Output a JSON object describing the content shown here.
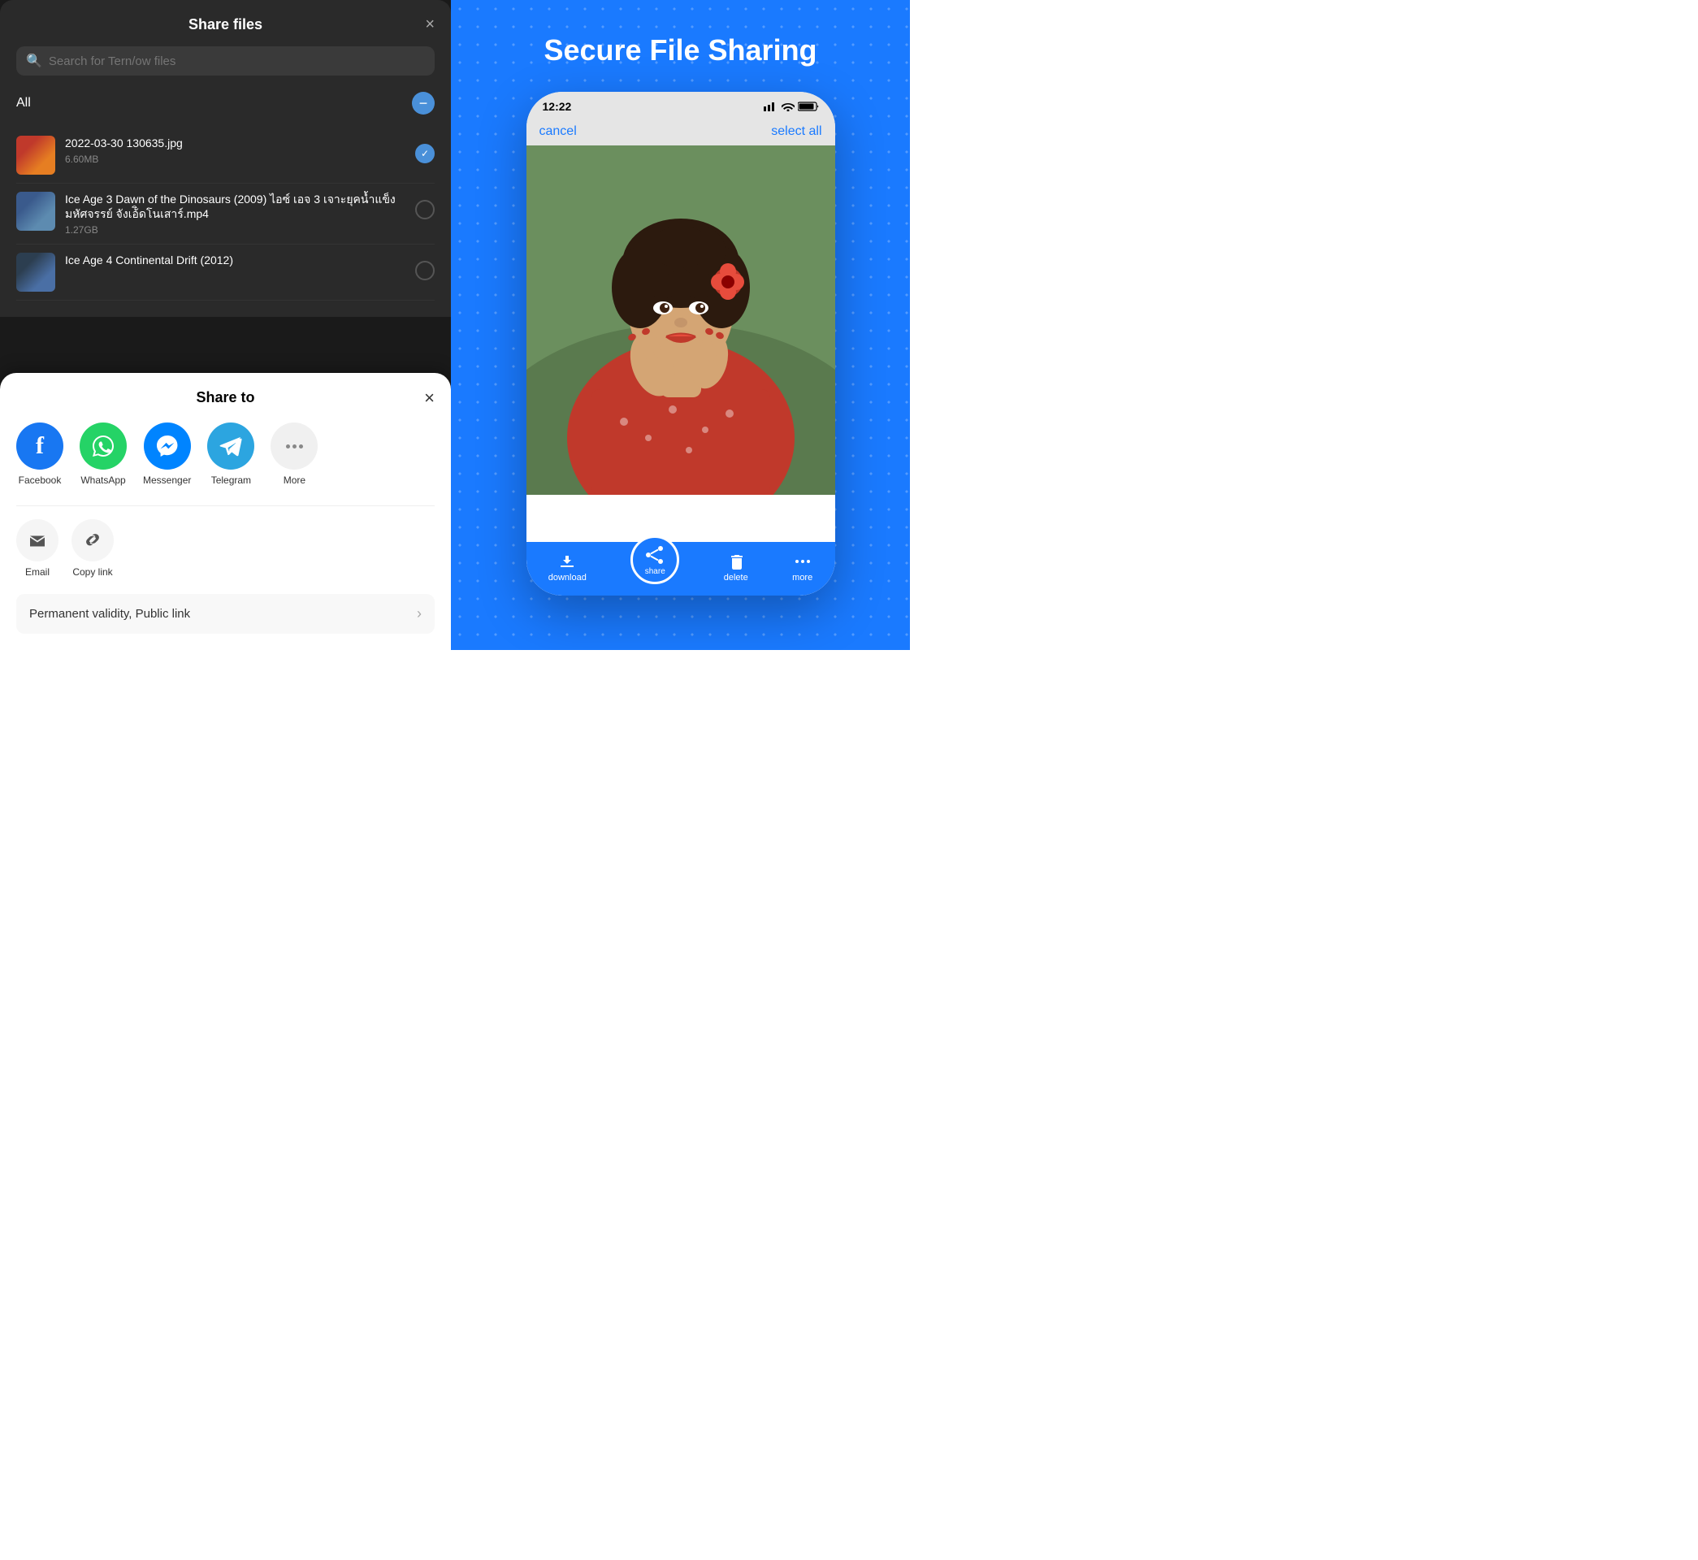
{
  "leftPanel": {
    "shareFilesDialog": {
      "title": "Share files",
      "closeBtn": "×",
      "searchPlaceholder": "Search for Tern/ow files",
      "allLabel": "All",
      "files": [
        {
          "name": "2022-03-30 130635.jpg",
          "size": "6.60MB",
          "checked": true
        },
        {
          "name": "Ice Age 3 Dawn of the Dinosaurs (2009) ไอซ์ เอจ 3 เจาะยุคน้ำแข็ง มหัศจรรย์ จังเอ้ิดโนเสาร์.mp4",
          "size": "1.27GB",
          "checked": false
        },
        {
          "name": "Ice Age 4 Continental Drift (2012)",
          "size": "",
          "checked": false
        }
      ]
    },
    "shareToSheet": {
      "title": "Share to",
      "closeBtn": "×",
      "apps": [
        {
          "id": "facebook",
          "label": "Facebook"
        },
        {
          "id": "whatsapp",
          "label": "WhatsApp"
        },
        {
          "id": "messenger",
          "label": "Messenger"
        },
        {
          "id": "telegram",
          "label": "Telegram"
        },
        {
          "id": "more",
          "label": "More"
        }
      ],
      "actions": [
        {
          "id": "email",
          "label": "Email",
          "icon": "👤+"
        },
        {
          "id": "copylink",
          "label": "Copy link",
          "icon": "🔗"
        }
      ],
      "permanentLink": {
        "text": "Permanent validity, Public link",
        "chevron": "›"
      }
    }
  },
  "rightPanel": {
    "title": "Secure File Sharing",
    "phone": {
      "statusBar": {
        "time": "12:22",
        "signal": "▐▐▐",
        "wifi": "wifi",
        "battery": "battery"
      },
      "toolbar": {
        "cancel": "cancel",
        "selectAll": "select all"
      },
      "bottomBar": {
        "download": "download",
        "share": "share",
        "delete": "delete",
        "more": "more"
      }
    }
  }
}
